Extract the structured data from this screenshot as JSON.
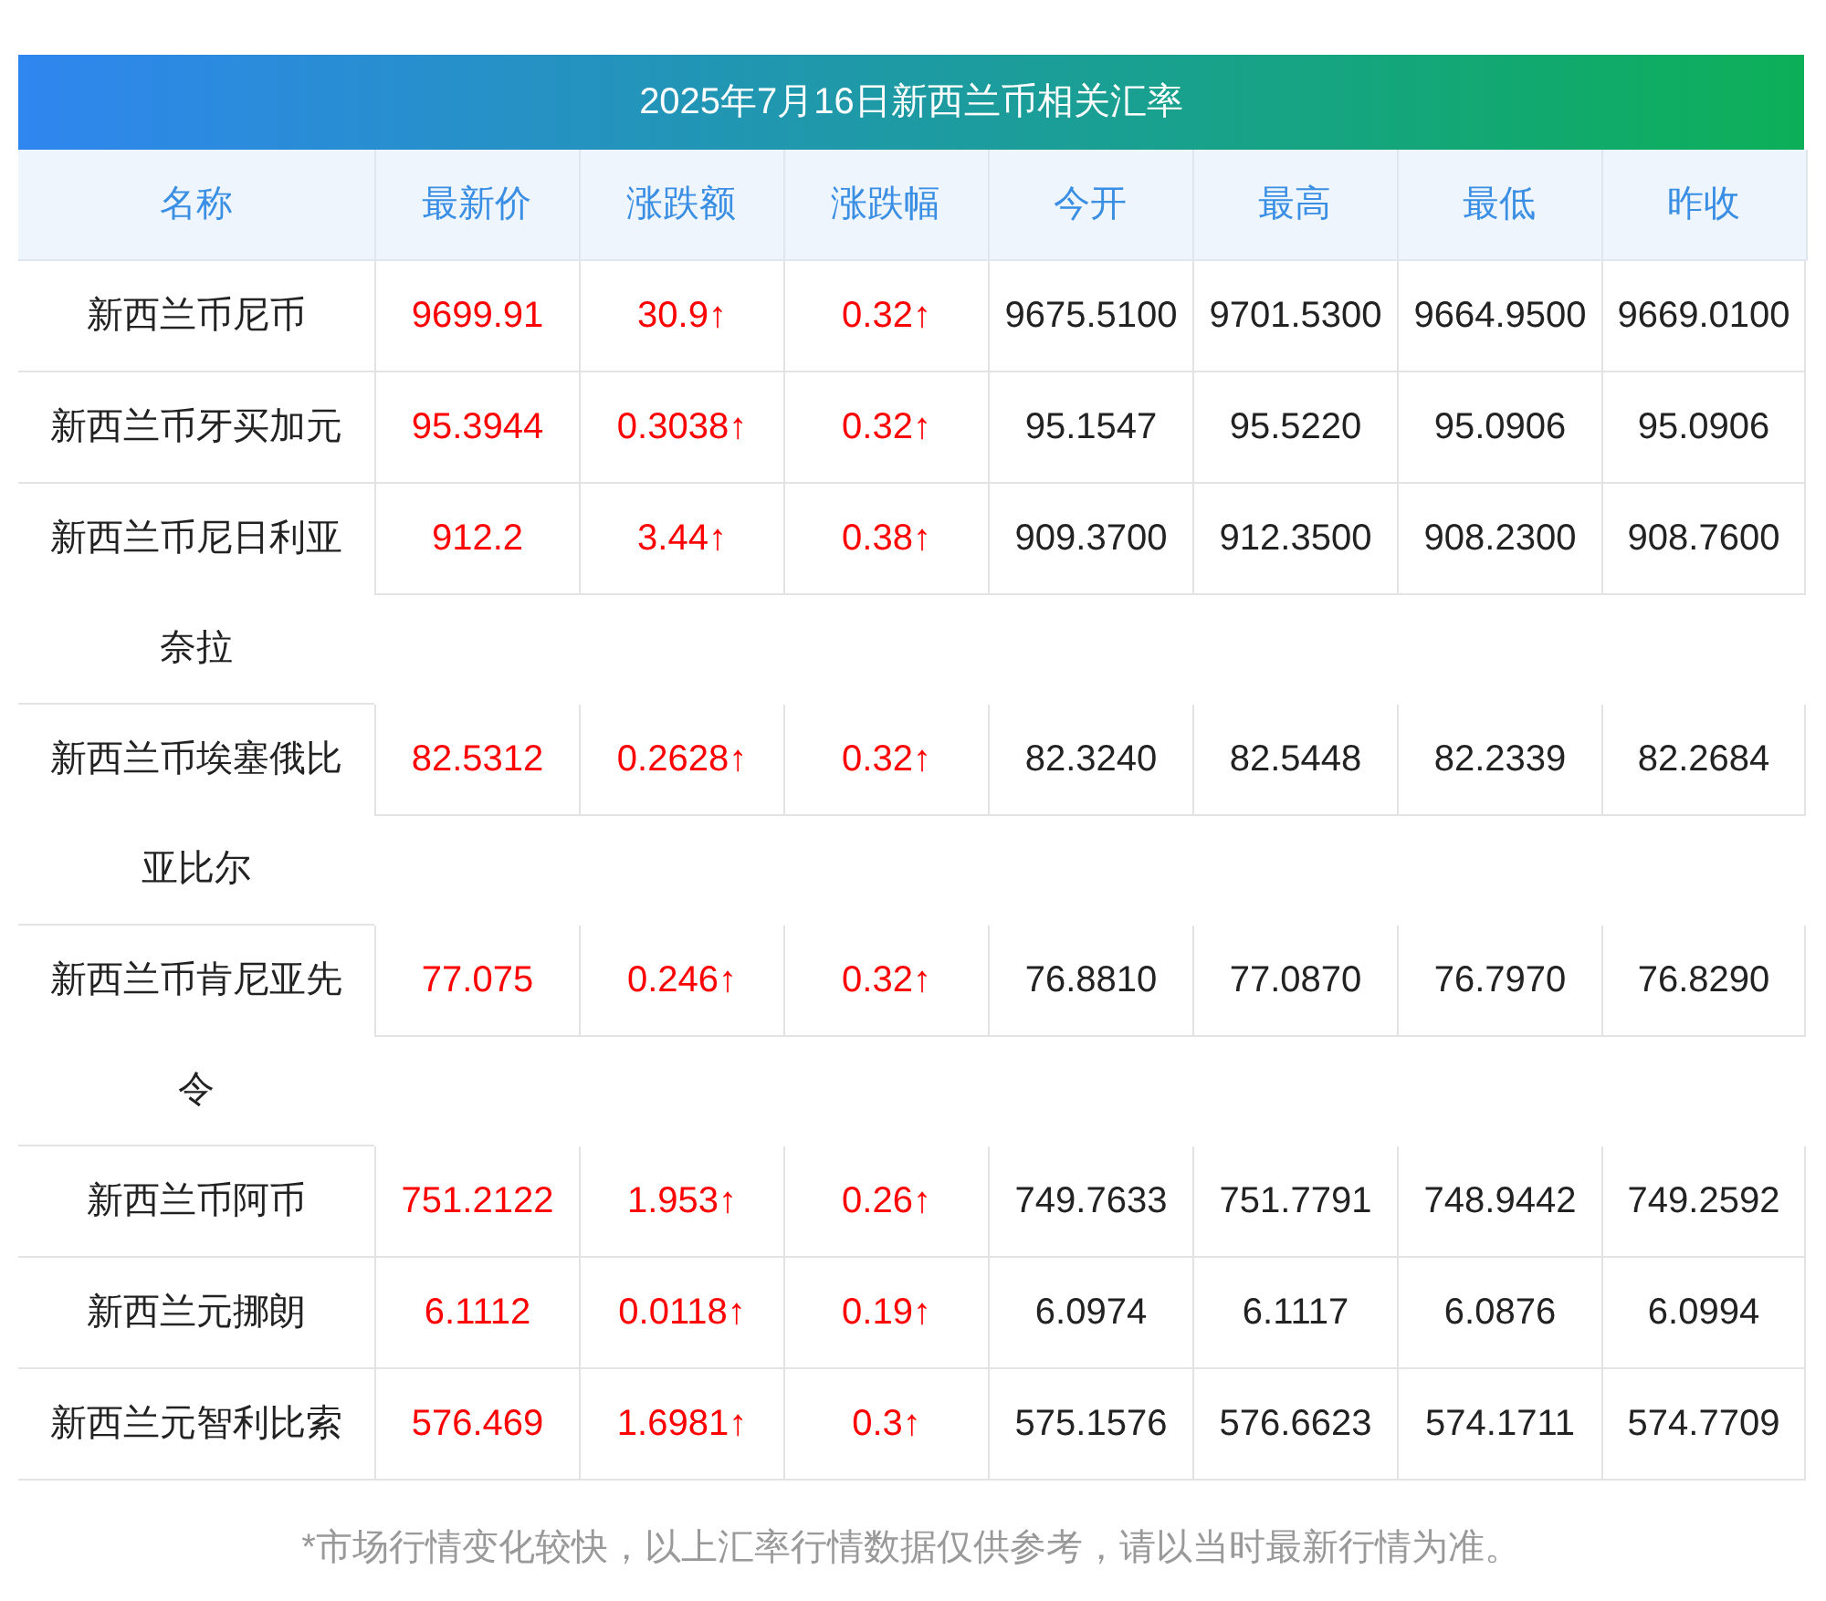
{
  "title": "2025年7月16日新西兰币相关汇率",
  "columns": [
    "名称",
    "最新价",
    "涨跌额",
    "涨跌幅",
    "今开",
    "最高",
    "最低",
    "昨收"
  ],
  "rows": [
    {
      "name": "新西兰币尼币",
      "rising": true,
      "cells": [
        "9699.91",
        "30.9↑",
        "0.32↑",
        "9675.5100",
        "9701.5300",
        "9664.9500",
        "9669.0100"
      ]
    },
    {
      "name": "新西兰币牙买加元",
      "rising": true,
      "cells": [
        "95.3944",
        "0.3038↑",
        "0.32↑",
        "95.1547",
        "95.5220",
        "95.0906",
        "95.0906"
      ]
    },
    {
      "name": "新西兰币尼日利亚奈拉",
      "rising": true,
      "cells": [
        "912.2",
        "3.44↑",
        "0.38↑",
        "909.3700",
        "912.3500",
        "908.2300",
        "908.7600"
      ]
    },
    {
      "name": "新西兰币埃塞俄比亚比尔",
      "rising": true,
      "cells": [
        "82.5312",
        "0.2628↑",
        "0.32↑",
        "82.3240",
        "82.5448",
        "82.2339",
        "82.2684"
      ]
    },
    {
      "name": "新西兰币肯尼亚先令",
      "rising": true,
      "cells": [
        "77.075",
        "0.246↑",
        "0.32↑",
        "76.8810",
        "77.0870",
        "76.7970",
        "76.8290"
      ]
    },
    {
      "name": "新西兰币阿币",
      "rising": true,
      "cells": [
        "751.2122",
        "1.953↑",
        "0.26↑",
        "749.7633",
        "751.7791",
        "748.9442",
        "749.2592"
      ]
    },
    {
      "name": "新西兰元挪朗",
      "rising": true,
      "cells": [
        "6.1112",
        "0.0118↑",
        "0.19↑",
        "6.0974",
        "6.1117",
        "6.0876",
        "6.0994"
      ]
    },
    {
      "name": "新西兰元智利比索",
      "rising": true,
      "cells": [
        "576.469",
        "1.6981↑",
        "0.3↑",
        "575.1576",
        "576.6623",
        "574.1711",
        "574.7709"
      ]
    }
  ],
  "note": "*市场行情变化较快，以上汇率行情数据仅供参考，请以当时最新行情为准。"
}
